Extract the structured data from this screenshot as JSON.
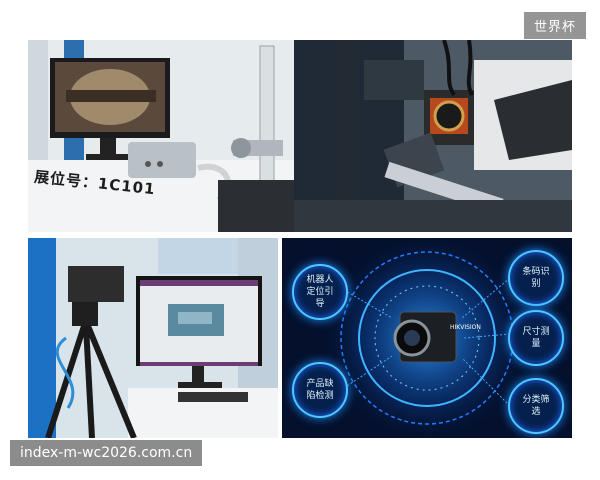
{
  "watermark_top": "世界杯",
  "watermark_bottom": "index-m-wc2026.com.cn",
  "booth_label": "展位号：1C101",
  "camera_brand": "HIKVISION",
  "features": {
    "robot_positioning": "机器人定位引导",
    "product_defect": "产品缺陷检测",
    "barcode": "条码识别",
    "measurement": "尺寸测量",
    "sorting": "分类筛选"
  }
}
